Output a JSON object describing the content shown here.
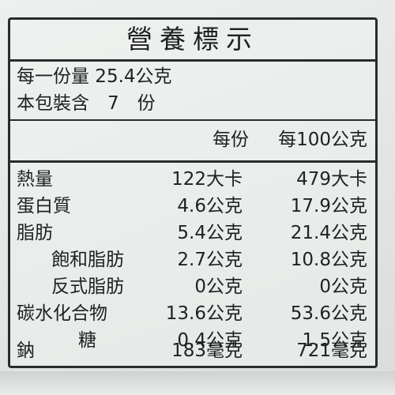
{
  "title": "營養標示",
  "serving_size": "每一份量 25.4公克",
  "servings_per_package": "本包裝含　7　份",
  "columns": {
    "per_serving": "每份",
    "per_100g": "每100公克"
  },
  "rows": [
    {
      "name": "熱量",
      "per_serving": "122大卡",
      "per_100g": "479大卡"
    },
    {
      "name": "蛋白質",
      "per_serving": "4.6公克",
      "per_100g": "17.9公克"
    },
    {
      "name": "脂肪",
      "per_serving": "5.4公克",
      "per_100g": "21.4公克"
    },
    {
      "name": "飽和脂肪",
      "per_serving": "2.7公克",
      "per_100g": "10.8公克"
    },
    {
      "name": "反式脂肪",
      "per_serving": "0公克",
      "per_100g": "0公克"
    },
    {
      "name": "碳水化合物",
      "per_serving": "13.6公克",
      "per_100g": "53.6公克"
    },
    {
      "name": "糖",
      "per_serving": "0.4公克",
      "per_100g": "1.5公克"
    },
    {
      "name": "鈉",
      "per_serving": "183毫克",
      "per_100g": "721毫克"
    }
  ]
}
